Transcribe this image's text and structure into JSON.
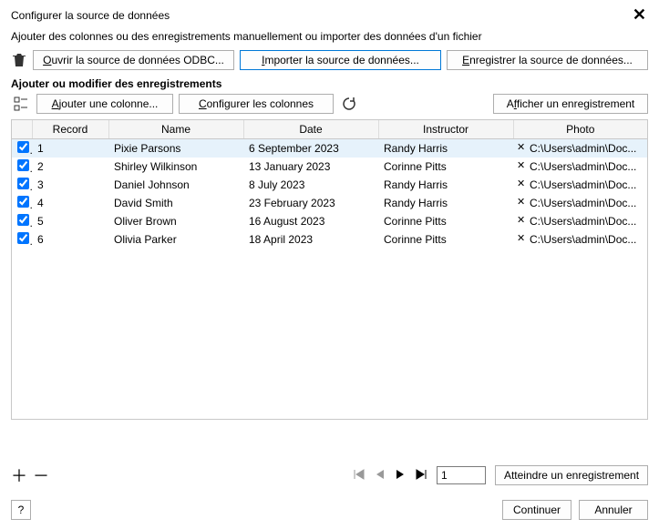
{
  "window": {
    "title": "Configurer la source de données"
  },
  "subtitle": "Ajouter des colonnes ou des enregistrements manuellement ou importer des données d'un fichier",
  "buttons": {
    "open_odbc": "Ouvrir la source de données ODBC...",
    "import": "Importer la source de données...",
    "save": "Enregistrer la source de données...",
    "add_column": "Ajouter une colonne...",
    "configure_columns": "Configurer les colonnes",
    "show_record": "Afficher un enregistrement",
    "goto_record": "Atteindre un enregistrement",
    "continue": "Continuer",
    "cancel": "Annuler",
    "help": "?"
  },
  "section_label": "Ajouter ou modifier des enregistrements",
  "columns": {
    "record": "Record",
    "name": "Name",
    "date": "Date",
    "instructor": "Instructor",
    "photo": "Photo"
  },
  "rows": [
    {
      "checked": true,
      "record": "1",
      "name": "Pixie Parsons",
      "date": "6 September 2023",
      "instructor": "Randy Harris",
      "photo": "C:\\Users\\admin\\Doc..."
    },
    {
      "checked": true,
      "record": "2",
      "name": "Shirley Wilkinson",
      "date": "13 January 2023",
      "instructor": "Corinne Pitts",
      "photo": "C:\\Users\\admin\\Doc..."
    },
    {
      "checked": true,
      "record": "3",
      "name": "Daniel Johnson",
      "date": "8 July 2023",
      "instructor": "Randy Harris",
      "photo": "C:\\Users\\admin\\Doc..."
    },
    {
      "checked": true,
      "record": "4",
      "name": "David Smith",
      "date": "23 February 2023",
      "instructor": "Randy Harris",
      "photo": "C:\\Users\\admin\\Doc..."
    },
    {
      "checked": true,
      "record": "5",
      "name": "Oliver Brown",
      "date": "16 August 2023",
      "instructor": "Corinne Pitts",
      "photo": "C:\\Users\\admin\\Doc..."
    },
    {
      "checked": true,
      "record": "6",
      "name": "Olivia Parker",
      "date": "18 April 2023",
      "instructor": "Corinne Pitts",
      "photo": "C:\\Users\\admin\\Doc..."
    }
  ],
  "nav": {
    "page_value": "1"
  }
}
